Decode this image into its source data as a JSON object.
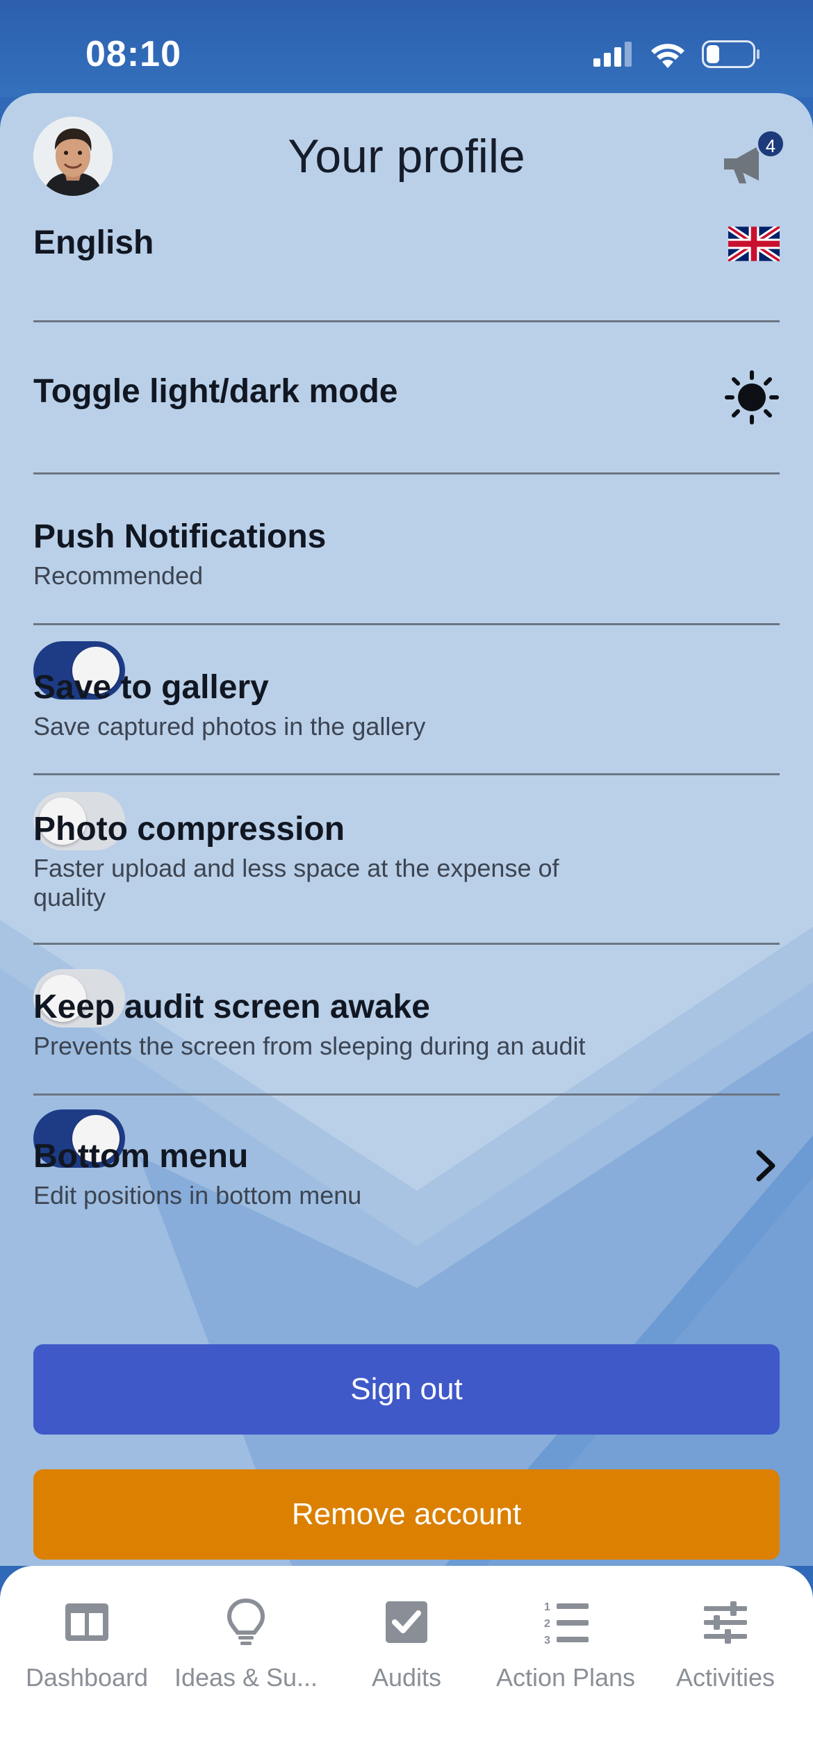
{
  "status_bar": {
    "time": "08:10"
  },
  "header": {
    "title": "Your profile",
    "notification_count": "4"
  },
  "language": {
    "label": "English"
  },
  "settings": [
    {
      "title": "Toggle light/dark mode"
    },
    {
      "title": "Push Notifications",
      "subtitle": "Recommended",
      "enabled": true
    },
    {
      "title": "Save to gallery",
      "subtitle": "Save captured photos in the gallery",
      "enabled": false
    },
    {
      "title": "Photo compression",
      "subtitle": "Faster upload and less space at the expense of quality",
      "enabled": false
    },
    {
      "title": "Keep audit screen awake",
      "subtitle": "Prevents the screen from sleeping during an audit",
      "enabled": true
    },
    {
      "title": "Bottom menu",
      "subtitle": "Edit positions in bottom menu"
    }
  ],
  "buttons": {
    "sign_out": "Sign out",
    "remove_account": "Remove account"
  },
  "tabs": [
    {
      "label": "Dashboard",
      "icon": "dashboard-icon"
    },
    {
      "label": "Ideas & Su...",
      "icon": "lightbulb-icon"
    },
    {
      "label": "Audits",
      "icon": "checkbox-icon"
    },
    {
      "label": "Action Plans",
      "icon": "numbered-list-icon"
    },
    {
      "label": "Activities",
      "icon": "sliders-icon"
    }
  ],
  "colors": {
    "toggle_on": "#1e3c86",
    "sign_out": "#3f59c9",
    "remove_account": "#db8000",
    "sheet_background": "#bad0e8"
  }
}
